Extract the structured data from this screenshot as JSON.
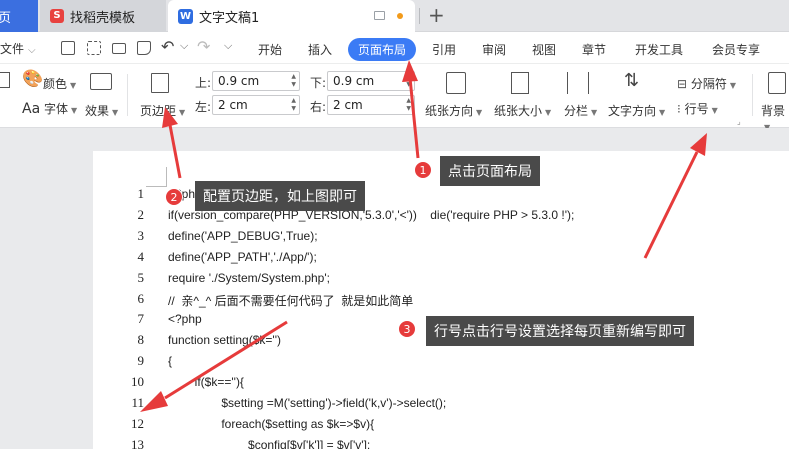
{
  "tabs": {
    "home_label": "页",
    "template_label": "找稻壳模板",
    "template_logo": "S",
    "doc_label": "文字文稿1",
    "doc_logo": "W",
    "add_glyph": "+"
  },
  "menu": {
    "file_label": "文件",
    "items": [
      "开始",
      "插入",
      "页面布局",
      "引用",
      "审阅",
      "视图",
      "章节",
      "开发工具",
      "会员专享"
    ],
    "active_index": 2
  },
  "ribbon": {
    "color_label": "颜色",
    "font_label": "字体",
    "effect_label": "效果",
    "margin_label": "页边距",
    "top_label": "上:",
    "top_value": "0.9 cm",
    "bottom_label": "下:",
    "bottom_value": "0.9 cm",
    "left_label": "左:",
    "left_value": "2 cm",
    "right_label": "右:",
    "right_value": "2 cm",
    "orientation_label": "纸张方向",
    "size_label": "纸张大小",
    "columns_label": "分栏",
    "text_direction_label": "文字方向",
    "separator_label": "分隔符",
    "line_number_label": "行号",
    "background_label": "背景"
  },
  "code_lines": [
    {
      "num": "1",
      "text": "<?php"
    },
    {
      "num": "2",
      "text": "if(version_compare(PHP_VERSION,'5.3.0','<'))    die('require PHP > 5.3.0 !');"
    },
    {
      "num": "3",
      "text": "define('APP_DEBUG',True);"
    },
    {
      "num": "4",
      "text": "define('APP_PATH','./App/');"
    },
    {
      "num": "5",
      "text": "require './System/System.php';"
    },
    {
      "num": "6",
      "text": "//  亲^_^ 后面不需要任何代码了  就是如此简单"
    },
    {
      "num": "7",
      "text": "<?php"
    },
    {
      "num": "8",
      "text": "function setting($k='')"
    },
    {
      "num": "9",
      "text": "{"
    },
    {
      "num": "10",
      "text": "        if($k==''){"
    },
    {
      "num": "11",
      "text": "                $setting =M('setting')->field('k,v')->select();"
    },
    {
      "num": "12",
      "text": "                foreach($setting as $k=>$v){"
    },
    {
      "num": "13",
      "text": "                        $config[$v['k']] = $v['v'];"
    }
  ],
  "annotations": [
    {
      "badge": "1",
      "text": "点击页面布局"
    },
    {
      "badge": "2",
      "text": "配置页边距，如上图即可"
    },
    {
      "badge": "3",
      "text": "行号点击行号设置选择每页重新编写即可"
    }
  ],
  "colors": {
    "accent": "#3b7bf5",
    "annotation_red": "#e63b3b",
    "callout_bg": "#4a4a4a"
  }
}
